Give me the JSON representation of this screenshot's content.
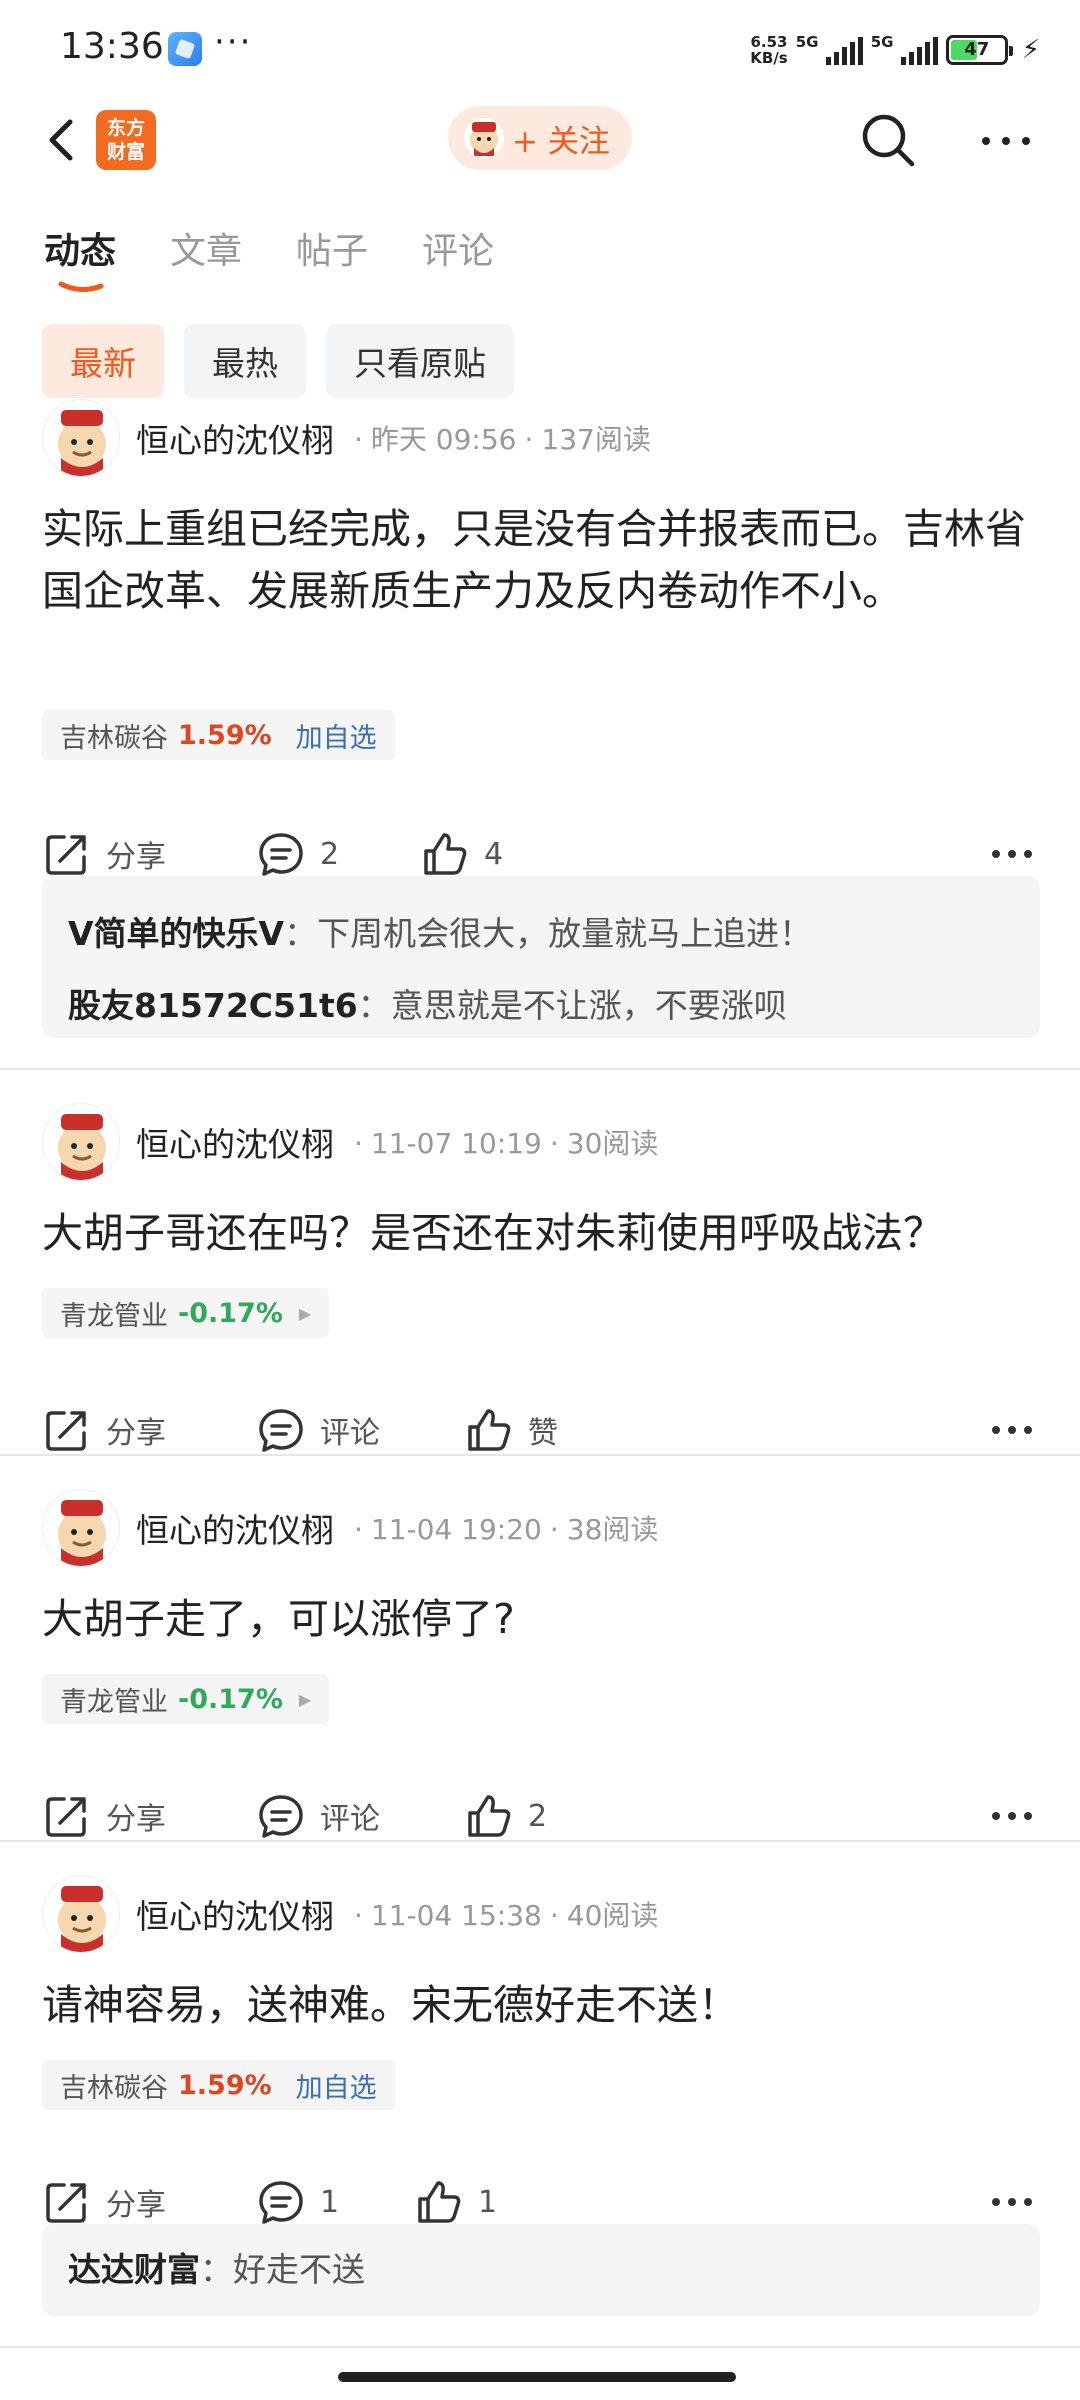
{
  "status_bar": {
    "time": "13:36",
    "dots": "···",
    "net_speed_value": "6.53",
    "net_speed_unit": "KB/s",
    "sim1": "5G",
    "sim2": "5G",
    "battery": "47",
    "battery_level": 0.47
  },
  "header": {
    "logo_line1": "东方",
    "logo_line2": "财富",
    "follow_label": "+ 关注"
  },
  "tabs": [
    {
      "label": "动态"
    },
    {
      "label": "文章"
    },
    {
      "label": "帖子"
    },
    {
      "label": "评论"
    }
  ],
  "filters": [
    {
      "label": "最新"
    },
    {
      "label": "最热"
    },
    {
      "label": "只看原贴"
    }
  ],
  "posts": [
    {
      "author": "恒心的沈仪栩",
      "time": "昨天 09:56",
      "reads": "137阅读",
      "content": "实际上重组已经完成，只是没有合并报表而已。吉林省国企改革、发展新质生产力及反内卷动作不小。",
      "stock": {
        "name": "吉林碳谷",
        "change": "1.59%",
        "extra": "加自选"
      },
      "share": "分享",
      "comment": "2",
      "like": "4",
      "comments": [
        {
          "user": "V简单的快乐V",
          "sep": "：",
          "text": "下周机会很大，放量就马上追进！"
        },
        {
          "user": "股友81572C51t6",
          "sep": "：",
          "text": "意思就是不让涨，不要涨呗"
        }
      ]
    },
    {
      "author": "恒心的沈仪栩",
      "time": "11-07 10:19",
      "reads": "30阅读",
      "content": "大胡子哥还在吗？是否还在对朱莉使用呼吸战法？",
      "stock": {
        "name": "青龙管业",
        "change": "-0.17%"
      },
      "share": "分享",
      "comment": "评论",
      "like": "赞"
    },
    {
      "author": "恒心的沈仪栩",
      "time": "11-04 19:20",
      "reads": "38阅读",
      "content": "大胡子走了，可以涨停了?",
      "stock": {
        "name": "青龙管业",
        "change": "-0.17%"
      },
      "share": "分享",
      "comment": "评论",
      "like": "2"
    },
    {
      "author": "恒心的沈仪栩",
      "time": "11-04 15:38",
      "reads": "40阅读",
      "content": "请神容易，送神难。宋无德好走不送！",
      "stock": {
        "name": "吉林碳谷",
        "change": "1.59%",
        "extra": "加自选"
      },
      "share": "分享",
      "comment": "1",
      "like": "1",
      "comments": [
        {
          "user": "达达财富",
          "sep": "：",
          "text": "好走不送"
        }
      ]
    }
  ],
  "colors": {
    "accent": "#f05a1a",
    "up": "#e0451d",
    "down": "#2eaa5a",
    "link": "#3b6fb6"
  }
}
